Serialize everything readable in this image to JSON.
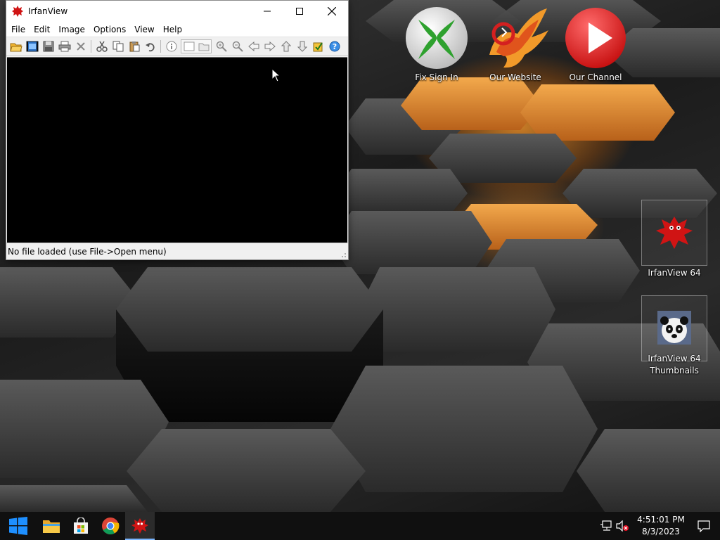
{
  "window": {
    "title": "IrfanView",
    "menu": [
      "File",
      "Edit",
      "Image",
      "Options",
      "View",
      "Help"
    ],
    "status": "No file loaded (use File->Open menu)"
  },
  "toolbar_icons": [
    "open-folder-icon",
    "slideshow-icon",
    "save-icon",
    "print-icon",
    "delete-icon",
    "cut-icon",
    "copy-icon",
    "paste-icon",
    "undo-icon",
    "info-icon",
    "thumbnails-icon",
    "zoom-in-icon",
    "zoom-out-icon",
    "previous-icon",
    "next-icon",
    "first-icon",
    "last-icon",
    "paint-icon",
    "help-icon"
  ],
  "desktop_icons": [
    {
      "label": "Fix Sign In",
      "icon": "xbox-icon"
    },
    {
      "label": "Our Website",
      "icon": "phoenix-icon"
    },
    {
      "label": "Our Channel",
      "icon": "play-icon"
    },
    {
      "label": "IrfanView 64",
      "icon": "irfanview-icon"
    },
    {
      "label_line1": "IrfanView 64",
      "label_line2": "Thumbnails",
      "icon": "panda-icon"
    }
  ],
  "taskbar": {
    "apps": [
      "start-icon",
      "file-explorer-icon",
      "store-icon",
      "chrome-icon",
      "irfanview-icon"
    ],
    "clock_time": "4:51:01 PM",
    "clock_date": "8/3/2023"
  },
  "colors": {
    "accent": "#0078d7",
    "taskbar": "#101010",
    "wallpaper_orange": "#e08a28"
  }
}
